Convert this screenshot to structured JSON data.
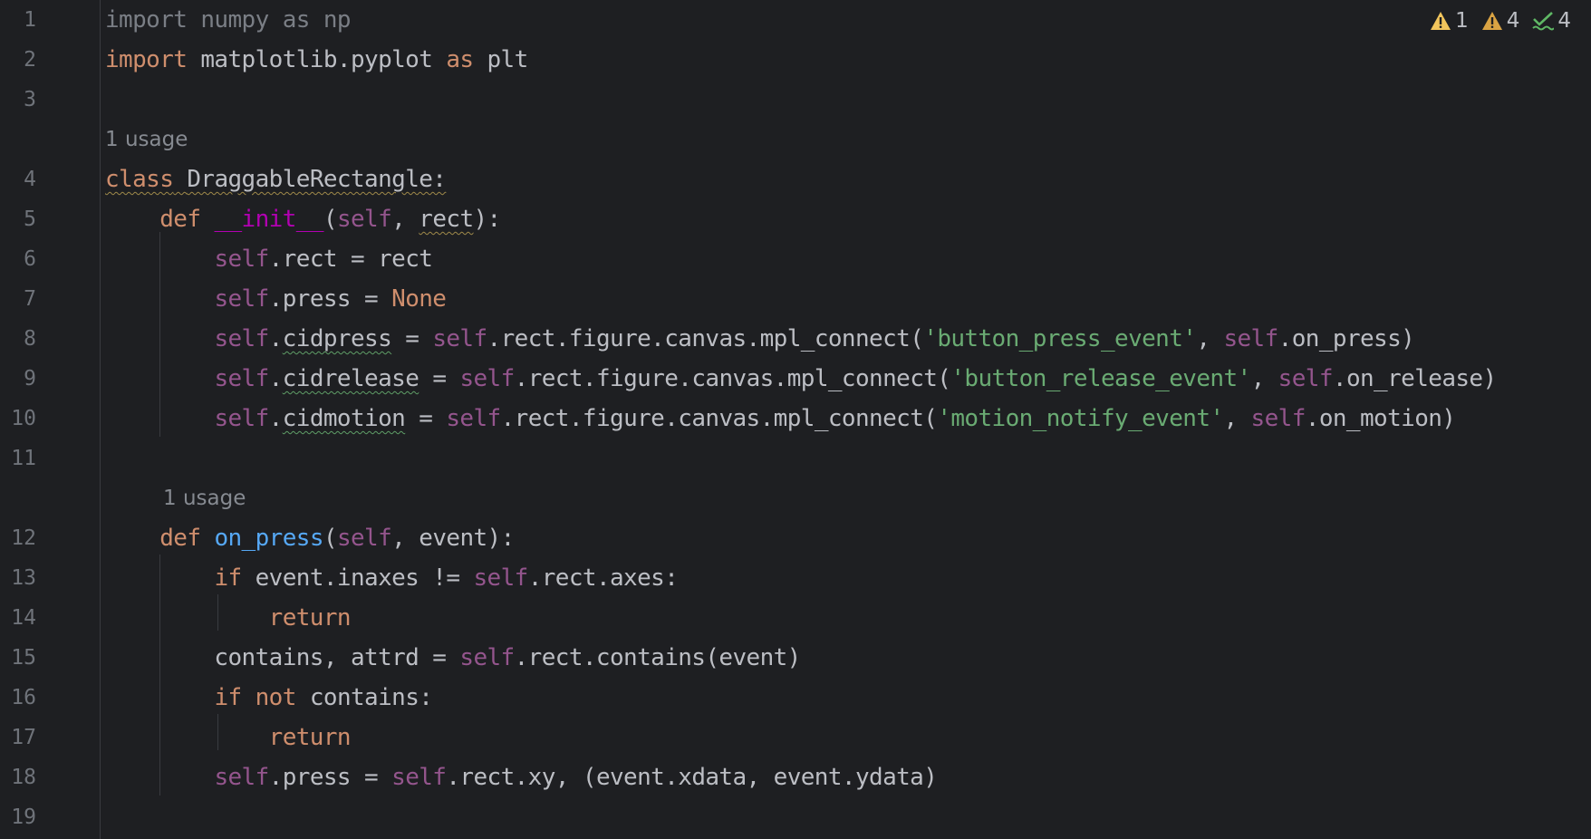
{
  "inspections": {
    "errors_count": "1",
    "warnings_count": "4",
    "weak_warnings_count": "4",
    "colors": {
      "error": "#f2c55c",
      "warning": "#d9a343",
      "ok": "#5fb865"
    }
  },
  "hints": {
    "usage_class": "1 usage",
    "usage_on_press": "1 usage"
  },
  "lines": {
    "l1": {
      "num": "1",
      "t": [
        "import numpy as np"
      ]
    },
    "l2": {
      "num": "2",
      "t": [
        "import",
        " matplotlib.pyplot ",
        "as",
        " plt"
      ]
    },
    "l3": {
      "num": "3",
      "t": []
    },
    "l4": {
      "num": "4",
      "t": [
        "class",
        " ",
        "DraggableRectangle:"
      ]
    },
    "l5": {
      "num": "5",
      "t": [
        "    ",
        "def",
        " ",
        "__init__",
        "(",
        "self",
        ", ",
        "rect",
        "):"
      ]
    },
    "l6": {
      "num": "6",
      "t": [
        "        ",
        "self",
        ".rect = rect"
      ]
    },
    "l7": {
      "num": "7",
      "t": [
        "        ",
        "self",
        ".press = ",
        "None"
      ]
    },
    "l8": {
      "num": "8",
      "t": [
        "        ",
        "self",
        ".",
        "cidpress",
        " = ",
        "self",
        ".rect.figure.canvas.mpl_connect(",
        "'button_press_event'",
        ", ",
        "self",
        ".on_press)"
      ]
    },
    "l9": {
      "num": "9",
      "t": [
        "        ",
        "self",
        ".",
        "cidrelease",
        " = ",
        "self",
        ".rect.figure.canvas.mpl_connect(",
        "'button_release_event'",
        ", ",
        "self",
        ".on_release)"
      ]
    },
    "l10": {
      "num": "10",
      "t": [
        "        ",
        "self",
        ".",
        "cidmotion",
        " = ",
        "self",
        ".rect.figure.canvas.mpl_connect(",
        "'motion_notify_event'",
        ", ",
        "self",
        ".on_motion)"
      ]
    },
    "l11": {
      "num": "11",
      "t": []
    },
    "l12": {
      "num": "12",
      "t": [
        "    ",
        "def",
        " ",
        "on_press",
        "(",
        "self",
        ", event):"
      ]
    },
    "l13": {
      "num": "13",
      "t": [
        "        ",
        "if",
        " event.inaxes != ",
        "self",
        ".rect.axes:"
      ]
    },
    "l14": {
      "num": "14",
      "t": [
        "            ",
        "return"
      ]
    },
    "l15": {
      "num": "15",
      "t": [
        "        contains, attrd = ",
        "self",
        ".rect.contains(event)"
      ]
    },
    "l16": {
      "num": "16",
      "t": [
        "        ",
        "if",
        " ",
        "not",
        " contains:"
      ]
    },
    "l17": {
      "num": "17",
      "t": [
        "            ",
        "return"
      ]
    },
    "l18": {
      "num": "18",
      "t": [
        "        ",
        "self",
        ".press = ",
        "self",
        ".rect.xy, (event.xdata, event.ydata)"
      ]
    },
    "l19": {
      "num": "19",
      "t": []
    }
  }
}
